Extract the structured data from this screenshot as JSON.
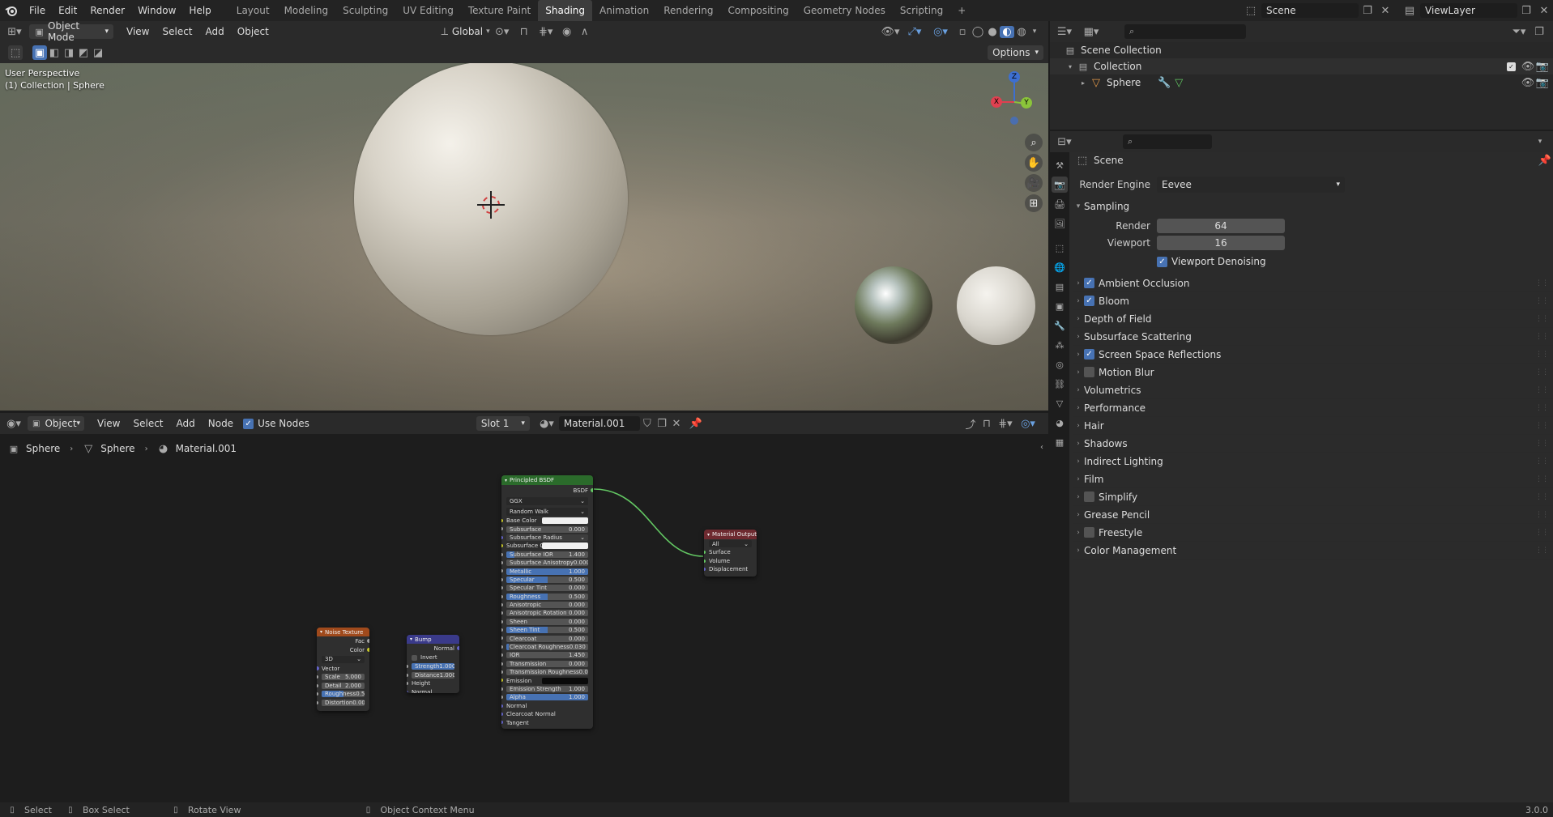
{
  "topbar": {
    "menus": [
      "File",
      "Edit",
      "Render",
      "Window",
      "Help"
    ],
    "workspaces": [
      "Layout",
      "Modeling",
      "Sculpting",
      "UV Editing",
      "Texture Paint",
      "Shading",
      "Animation",
      "Rendering",
      "Compositing",
      "Geometry Nodes",
      "Scripting"
    ],
    "active_workspace": "Shading",
    "add_tab": "+",
    "scene": "Scene",
    "view_layer": "ViewLayer"
  },
  "viewport": {
    "mode": "Object Mode",
    "menus": [
      "View",
      "Select",
      "Add",
      "Object"
    ],
    "transform_orientation": "Global",
    "options_label": "Options",
    "overlay_title": "User Perspective",
    "overlay_subtitle": "(1) Collection | Sphere",
    "gizmo": {
      "x": "X",
      "y": "Y",
      "z": "Z"
    }
  },
  "outliner": {
    "scene_collection": "Scene Collection",
    "collection": "Collection",
    "object": "Sphere"
  },
  "properties": {
    "context_title": "Scene",
    "render_engine_label": "Render Engine",
    "render_engine_value": "Eevee",
    "sampling_label": "Sampling",
    "render_label": "Render",
    "render_value": "64",
    "viewport_label": "Viewport",
    "viewport_value": "16",
    "viewport_denoising": "Viewport Denoising",
    "panels": [
      {
        "label": "Ambient Occlusion",
        "checkbox": true,
        "checked": true
      },
      {
        "label": "Bloom",
        "checkbox": true,
        "checked": true
      },
      {
        "label": "Depth of Field",
        "checkbox": false,
        "checked": false
      },
      {
        "label": "Subsurface Scattering",
        "checkbox": false,
        "checked": false
      },
      {
        "label": "Screen Space Reflections",
        "checkbox": true,
        "checked": true
      },
      {
        "label": "Motion Blur",
        "checkbox": true,
        "checked": false
      },
      {
        "label": "Volumetrics",
        "checkbox": false,
        "checked": false
      },
      {
        "label": "Performance",
        "checkbox": false,
        "checked": false
      },
      {
        "label": "Hair",
        "checkbox": false,
        "checked": false
      },
      {
        "label": "Shadows",
        "checkbox": false,
        "checked": false
      },
      {
        "label": "Indirect Lighting",
        "checkbox": false,
        "checked": false
      },
      {
        "label": "Film",
        "checkbox": false,
        "checked": false
      },
      {
        "label": "Simplify",
        "checkbox": true,
        "checked": false
      },
      {
        "label": "Grease Pencil",
        "checkbox": false,
        "checked": false
      },
      {
        "label": "Freestyle",
        "checkbox": true,
        "checked": false
      },
      {
        "label": "Color Management",
        "checkbox": false,
        "checked": false
      }
    ]
  },
  "node_editor": {
    "mode": "Object",
    "menus": [
      "View",
      "Select",
      "Add",
      "Node"
    ],
    "use_nodes": "Use Nodes",
    "slot": "Slot 1",
    "material": "Material.001",
    "breadcrumb": [
      "Sphere",
      "Sphere",
      "Material.001"
    ],
    "principled": {
      "title": "Principled BSDF",
      "output": "BSDF",
      "distribution": "GGX",
      "subsurface_method": "Random Walk",
      "rows": [
        {
          "label": "Base Color",
          "type": "color",
          "value": ""
        },
        {
          "label": "Subsurface",
          "type": "num",
          "value": "0.000",
          "fill": 0
        },
        {
          "label": "Subsurface Radius",
          "type": "drop",
          "value": ""
        },
        {
          "label": "Subsurface Co",
          "type": "color",
          "value": ""
        },
        {
          "label": "Subsurface IOR",
          "type": "num",
          "value": "1.400",
          "fill": 0.1
        },
        {
          "label": "Subsurface Anisotropy",
          "type": "num",
          "value": "0.000",
          "fill": 0
        },
        {
          "label": "Metallic",
          "type": "num",
          "value": "1.000",
          "fill": 1
        },
        {
          "label": "Specular",
          "type": "num",
          "value": "0.500",
          "fill": 0.5
        },
        {
          "label": "Specular Tint",
          "type": "num",
          "value": "0.000",
          "fill": 0
        },
        {
          "label": "Roughness",
          "type": "num",
          "value": "0.500",
          "fill": 0.5
        },
        {
          "label": "Anisotropic",
          "type": "num",
          "value": "0.000",
          "fill": 0
        },
        {
          "label": "Anisotropic Rotation",
          "type": "num",
          "value": "0.000",
          "fill": 0
        },
        {
          "label": "Sheen",
          "type": "num",
          "value": "0.000",
          "fill": 0
        },
        {
          "label": "Sheen Tint",
          "type": "num",
          "value": "0.500",
          "fill": 0.5
        },
        {
          "label": "Clearcoat",
          "type": "num",
          "value": "0.000",
          "fill": 0
        },
        {
          "label": "Clearcoat Roughness",
          "type": "num",
          "value": "0.030",
          "fill": 0.03
        },
        {
          "label": "IOR",
          "type": "num",
          "value": "1.450",
          "fill": 0
        },
        {
          "label": "Transmission",
          "type": "num",
          "value": "0.000",
          "fill": 0
        },
        {
          "label": "Transmission Roughness",
          "type": "num",
          "value": "0.000",
          "fill": 0
        },
        {
          "label": "Emission",
          "type": "colordark",
          "value": ""
        },
        {
          "label": "Emission Strength",
          "type": "num",
          "value": "1.000",
          "fill": 0
        },
        {
          "label": "Alpha",
          "type": "num",
          "value": "1.000",
          "fill": 1
        },
        {
          "label": "Normal",
          "type": "sock",
          "value": ""
        },
        {
          "label": "Clearcoat Normal",
          "type": "sock",
          "value": ""
        },
        {
          "label": "Tangent",
          "type": "sock",
          "value": ""
        }
      ]
    },
    "output_node": {
      "title": "Material Output",
      "target": "All",
      "inputs": [
        "Surface",
        "Volume",
        "Displacement"
      ]
    },
    "noise": {
      "title": "Noise Texture",
      "outputs": [
        "Fac",
        "Color"
      ],
      "dimension": "3D",
      "vector": "Vector",
      "rows": [
        {
          "label": "Scale",
          "value": "5.000",
          "fill": 0
        },
        {
          "label": "Detail",
          "value": "2.000",
          "fill": 0
        },
        {
          "label": "Roughness",
          "value": "0.500",
          "fill": 0.5
        },
        {
          "label": "Distortion",
          "value": "0.000",
          "fill": 0
        }
      ]
    },
    "bump": {
      "title": "Bump",
      "output": "Normal",
      "invert": "Invert",
      "rows": [
        {
          "label": "Strength",
          "value": "1.000",
          "fill": 1
        },
        {
          "label": "Distance",
          "value": "1.000",
          "fill": 0
        }
      ],
      "inputs": [
        "Height",
        "Normal"
      ]
    }
  },
  "statusbar": {
    "select": "Select",
    "box_select": "Box Select",
    "rotate_view": "Rotate View",
    "context_menu": "Object Context Menu",
    "version": "3.0.0"
  }
}
